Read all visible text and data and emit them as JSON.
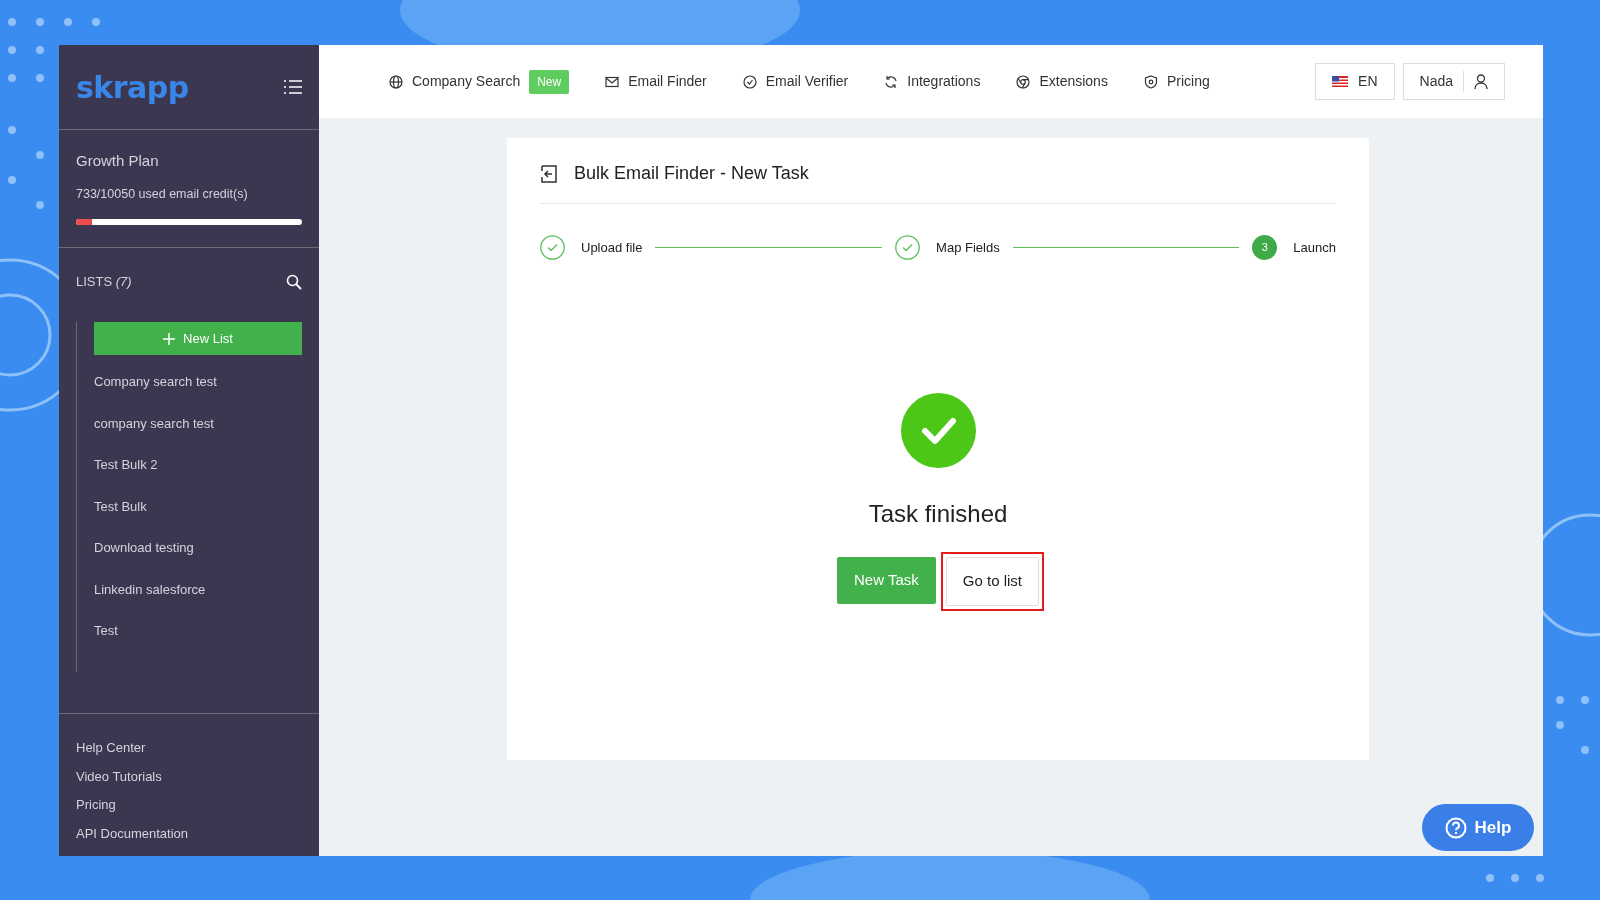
{
  "sidebar": {
    "logo": "skrapp",
    "plan": {
      "name": "Growth Plan",
      "credits": "733/10050 used email credit(s)",
      "level": 0.073
    },
    "lists_label": "LISTS",
    "lists_count": "(7)",
    "new_list_button": "New List",
    "lists": [
      "Company search test",
      "company search test",
      "Test Bulk 2",
      "Test Bulk",
      "Download testing",
      "Linkedin salesforce",
      "Test"
    ],
    "footer_links": [
      "Help Center",
      "Video Tutorials",
      "Pricing",
      "API Documentation"
    ]
  },
  "topnav": {
    "items": [
      {
        "kind": "globe",
        "label": "Company Search",
        "badge": "New"
      },
      {
        "kind": "mail",
        "label": "Email Finder"
      },
      {
        "kind": "check",
        "label": "Email Verifier"
      },
      {
        "kind": "sync",
        "label": "Integrations"
      },
      {
        "kind": "chrome",
        "label": "Extensions"
      },
      {
        "kind": "shield",
        "label": "Pricing"
      }
    ],
    "language": "EN",
    "user": "Nada"
  },
  "panel": {
    "title": "Bulk Email Finder - New Task",
    "steps": [
      {
        "label": "Upload file",
        "completed": true
      },
      {
        "label": "Map Fields",
        "completed": true
      },
      {
        "label": "Launch",
        "completed": false,
        "number": "3"
      }
    ],
    "result": "Task finished",
    "buttons": [
      {
        "label": "New Task",
        "kind": "primary",
        "highlighted": false
      },
      {
        "label": "Go to list",
        "kind": "secondary",
        "highlighted": true
      }
    ]
  },
  "help_button": "Help"
}
